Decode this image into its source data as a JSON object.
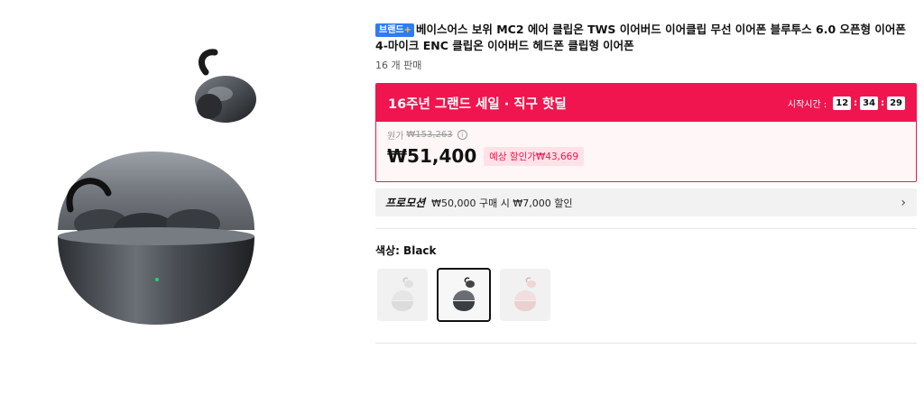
{
  "product": {
    "brand_badge": "브랜드",
    "brand_plus": "+",
    "title": "베이스어스 보위 MC2 에어 클립온 TWS 이어버드 이어클립 무선 이어폰 블루투스 6.0 오픈형 이어폰 4-마이크 ENC 클립온 이어버드 헤드폰 클립형 이어폰",
    "sold": "16 개 판매"
  },
  "deal": {
    "title": "16주년 그랜드 세일 · 직구 핫딜",
    "timer_label": "시작시간 :",
    "hours": "12",
    "minutes": "34",
    "seconds": "29",
    "orig_label": "원가",
    "orig_price": "₩153,263",
    "info_icon": "i",
    "price": "₩51,400",
    "expected": "예상 할인가₩43,669"
  },
  "promo": {
    "label": "프로모션",
    "text": "₩50,000 구매 시 ₩7,000 할인",
    "chevron": "›"
  },
  "color": {
    "label": "색상: Black",
    "options": [
      "white",
      "black",
      "pink"
    ],
    "selected": "black"
  },
  "colors": {
    "accent": "#f0154e",
    "brand_badge": "#2f7bf5"
  }
}
